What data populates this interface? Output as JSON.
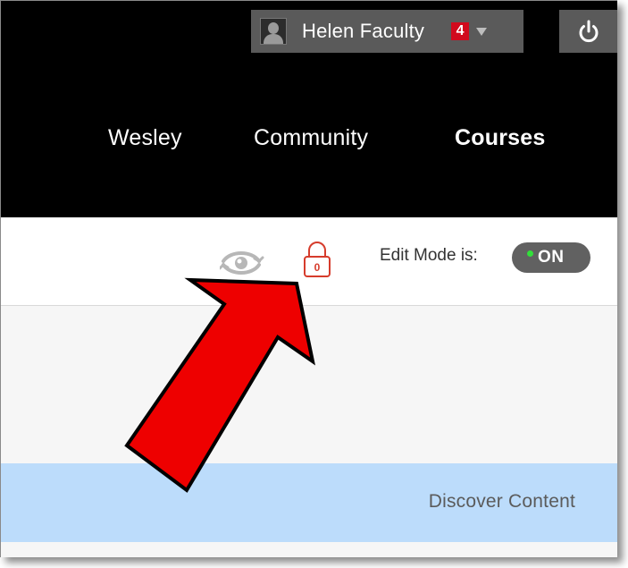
{
  "header": {
    "user_name": "Helen Faculty",
    "notification_count": "4",
    "nav": [
      {
        "label": "Wesley"
      },
      {
        "label": "Community"
      },
      {
        "label": "Courses"
      }
    ]
  },
  "toolbar": {
    "lock_count": "0",
    "edit_mode_label": "Edit Mode is:",
    "edit_mode_state": "ON"
  },
  "content": {
    "discover_label": "Discover Content"
  },
  "icons": {
    "user": "avatar-icon",
    "notifications_caret": "chevron-down-icon",
    "logout": "power-icon",
    "preview": "student-preview-icon",
    "lock": "lock-icon",
    "annotation": "red-arrow-annotation"
  },
  "colors": {
    "header_bg": "#000000",
    "user_menu_bg": "#5a5a5a",
    "badge": "#d10a1d",
    "lock": "#d63c2c",
    "toggle_bg": "#616161",
    "toggle_indicator": "#32e03a",
    "discover_bg": "#bcdcfb",
    "arrow_fill": "#ee0000"
  }
}
